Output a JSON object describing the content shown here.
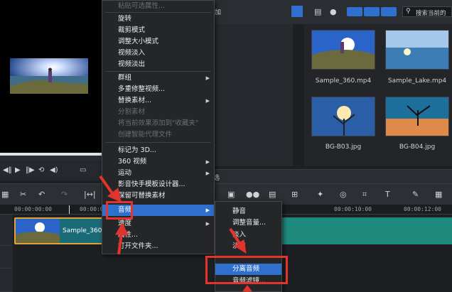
{
  "library": {
    "top_label": "加",
    "search_placeholder": "搜索当前的",
    "thumbnails": [
      {
        "label": "Sample_360.mp4"
      },
      {
        "label": "Sample_Lake.mp4"
      },
      {
        "label": "BG-B03.jpg"
      },
      {
        "label": "BG-B04.jpg"
      }
    ],
    "tab_label": "选"
  },
  "ruler": {
    "timecodes": [
      "00:00:00:00",
      "00:00:02",
      "00:00:10:00",
      "00:00:12:00"
    ]
  },
  "timeline": {
    "clip_label": "Sample_360.m"
  },
  "context_menu": {
    "items": [
      {
        "label": "粘贴可选属性...",
        "disabled": true
      },
      {
        "label": "旋转"
      },
      {
        "label": "裁剪模式"
      },
      {
        "label": "调整大小模式"
      },
      {
        "label": "视频淡入"
      },
      {
        "label": "视频淡出"
      },
      {
        "label": "群组",
        "submenu": true
      },
      {
        "label": "多重修整视频..."
      },
      {
        "label": "替换素材...",
        "submenu": true
      },
      {
        "label": "分割素材",
        "disabled": true
      },
      {
        "label": "将当前效果添加到\"收藏夹\"",
        "disabled": true
      },
      {
        "label": "创建智能代理文件",
        "disabled": true
      },
      {
        "label": "标记为 3D..."
      },
      {
        "label": "360 视频",
        "submenu": true
      },
      {
        "label": "运动",
        "submenu": true
      },
      {
        "label": "影音快手模板设计器..."
      },
      {
        "label": "保留可替换素材"
      },
      {
        "label": "音频",
        "submenu": true,
        "highlight": true
      },
      {
        "label": "速度",
        "submenu": true
      },
      {
        "label": "属性..."
      },
      {
        "label": "打开文件夹..."
      }
    ]
  },
  "audio_submenu": {
    "items": [
      {
        "label": "静音"
      },
      {
        "label": "调整音量..."
      },
      {
        "label": "淡入"
      },
      {
        "label": "淡出"
      },
      {
        "label": "分离音频"
      },
      {
        "label": "音频滤镜..."
      }
    ]
  },
  "colors": {
    "highlight": "#2f6fce",
    "annotation": "#e2342c",
    "clip_border": "#e0a33a"
  }
}
